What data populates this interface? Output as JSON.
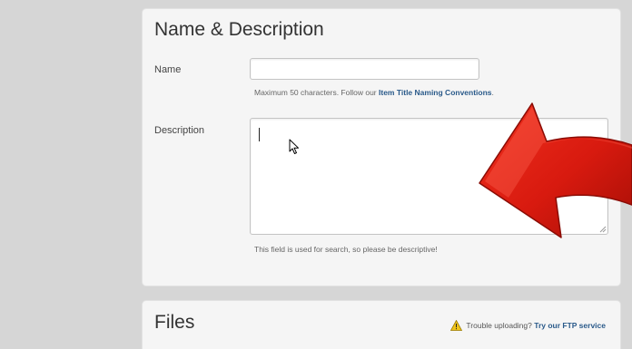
{
  "name_section": {
    "title": "Name & Description",
    "name_label": "Name",
    "name_value": "",
    "name_help_prefix": "Maximum 50 characters. Follow our ",
    "name_help_link": "Item Title Naming Conventions",
    "name_help_suffix": ".",
    "description_label": "Description",
    "description_value": "",
    "description_help": "This field is used for search, so please be descriptive!"
  },
  "files_section": {
    "title": "Files",
    "trouble_text": "Trouble uploading?",
    "ftp_link": "Try our FTP service"
  },
  "icons": {
    "warning": "warning-icon",
    "cursor": "mouse-pointer-icon",
    "arrow": "red-arrow-icon"
  },
  "colors": {
    "page_background": "#d6d6d6",
    "panel_background": "#f5f5f5",
    "link": "#2a5a8a",
    "arrow_red": "#d81a0f",
    "warning_yellow": "#f0c419"
  }
}
